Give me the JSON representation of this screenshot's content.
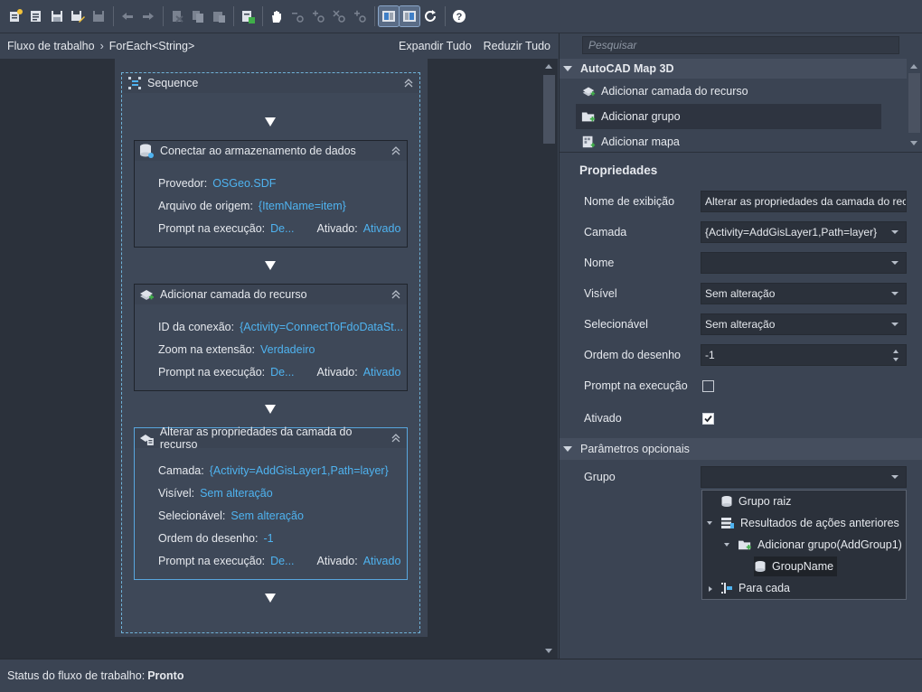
{
  "toolbar": {
    "icons": [
      "new-icon",
      "open-icon",
      "save-icon",
      "save-as-icon",
      "disabled-save-icon",
      "undo-icon",
      "redo-icon",
      "cut-icon",
      "copy-icon",
      "paste-icon",
      "run-icon",
      "pan-icon",
      "zoom-out-icon",
      "zoom-in-icon",
      "zoom-reset-icon",
      "zoom-fit-icon",
      "layout-icon",
      "layout-alt-icon",
      "refresh-icon",
      "help-icon"
    ]
  },
  "breadcrumb": {
    "root": "Fluxo de trabalho",
    "current": "ForEach<String>"
  },
  "header_actions": {
    "expand": "Expandir Tudo",
    "collapse": "Reduzir Tudo"
  },
  "sequence": {
    "title": "Sequence"
  },
  "activities": [
    {
      "title": "Conectar ao armazenamento de dados",
      "props": [
        {
          "label": "Provedor:",
          "value": "OSGeo.SDF"
        },
        {
          "label": "Arquivo de origem:",
          "value": "{ItemName=item}"
        }
      ],
      "prompt_label": "Prompt na execução:",
      "prompt_value": "De...",
      "enabled_label": "Ativado:",
      "enabled_value": "Ativado"
    },
    {
      "title": "Adicionar camada do recurso",
      "props": [
        {
          "label": "ID da conexão:",
          "value": "{Activity=ConnectToFdoDataSt..."
        },
        {
          "label": "Zoom na extensão:",
          "value": "Verdadeiro"
        }
      ],
      "prompt_label": "Prompt na execução:",
      "prompt_value": "De...",
      "enabled_label": "Ativado:",
      "enabled_value": "Ativado"
    },
    {
      "title": "Alterar as propriedades da camada do recurso",
      "props": [
        {
          "label": "Camada:",
          "value": "{Activity=AddGisLayer1,Path=layer}"
        },
        {
          "label": "Visível:",
          "value": "Sem alteração"
        },
        {
          "label": "Selecionável:",
          "value": "Sem alteração"
        },
        {
          "label": "Ordem do desenho:",
          "value": "-1"
        }
      ],
      "prompt_label": "Prompt na execução:",
      "prompt_value": "De...",
      "enabled_label": "Ativado:",
      "enabled_value": "Ativado"
    }
  ],
  "library": {
    "search_placeholder": "Pesquisar",
    "group": "AutoCAD Map 3D",
    "items": [
      "Adicionar camada do recurso",
      "Adicionar grupo",
      "Adicionar mapa"
    ]
  },
  "properties": {
    "title": "Propriedades",
    "display_name_label": "Nome de exibição",
    "display_name_value": "Alterar as propriedades da camada do recurso",
    "layer_label": "Camada",
    "layer_value": "{Activity=AddGisLayer1,Path=layer}",
    "name_label": "Nome",
    "name_value": "",
    "visible_label": "Visível",
    "visible_value": "Sem alteração",
    "selectable_label": "Selecionável",
    "selectable_value": "Sem alteração",
    "draw_order_label": "Ordem do desenho",
    "draw_order_value": "-1",
    "prompt_label": "Prompt na execução",
    "prompt_checked": false,
    "enabled_label": "Ativado",
    "enabled_checked": true
  },
  "optional": {
    "title": "Parâmetros opcionais",
    "group_label": "Grupo",
    "group_value": "",
    "tree": [
      "Grupo raiz",
      "Resultados de ações anteriores",
      "Adicionar grupo(AddGroup1)",
      "GroupName",
      "Para cada"
    ]
  },
  "status": {
    "label": "Status do fluxo de trabalho:",
    "value": "Pronto"
  },
  "colors": {
    "link": "#4fb3f0",
    "selection_border": "#58a6de",
    "panel": "#3b4453",
    "canvas": "#2b313b"
  }
}
